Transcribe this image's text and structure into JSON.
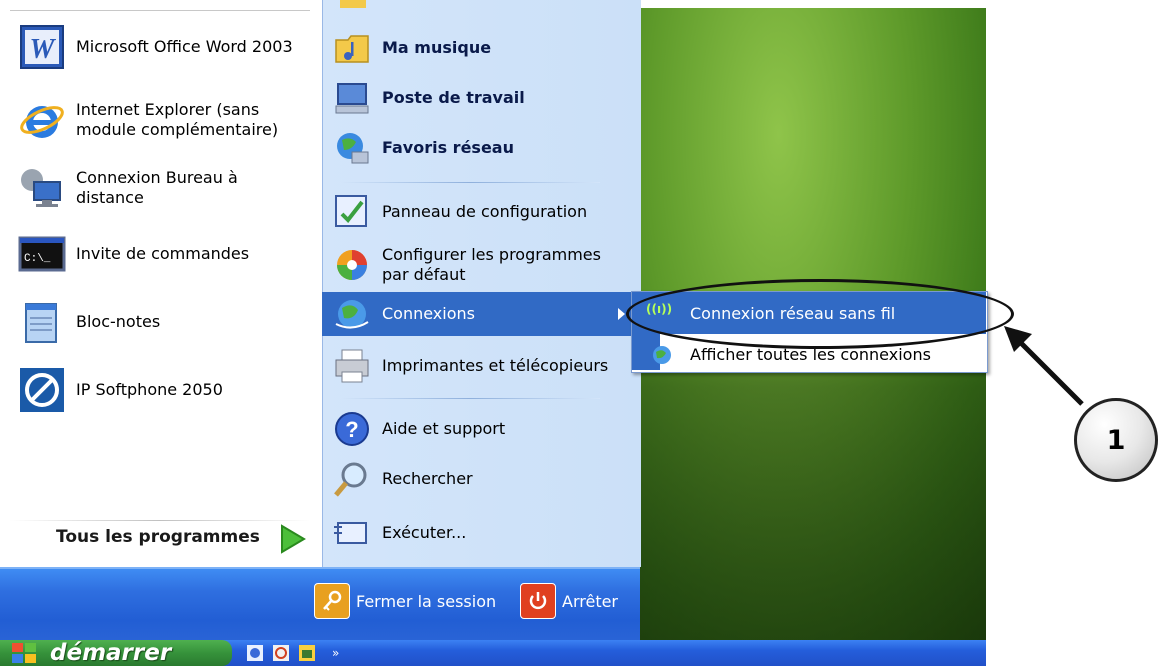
{
  "left_programs": [
    {
      "label": "Microsoft Office Word 2003",
      "icon": "word-icon"
    },
    {
      "label": "Internet Explorer (sans module complémentaire)",
      "icon": "internet-explorer-icon"
    },
    {
      "label": "Connexion Bureau à distance",
      "icon": "remote-desktop-icon"
    },
    {
      "label": "Invite de commandes",
      "icon": "command-prompt-icon"
    },
    {
      "label": "Bloc-notes",
      "icon": "notepad-icon"
    },
    {
      "label": "IP Softphone 2050",
      "icon": "softphone-icon"
    }
  ],
  "all_programs_label": "Tous les programmes",
  "right_items": {
    "music": "Ma musique",
    "computer": "Poste de travail",
    "network": "Favoris réseau",
    "control_panel": "Panneau de configuration",
    "default_programs": "Configurer les programmes par défaut",
    "connections": "Connexions",
    "printers": "Imprimantes et télécopieurs",
    "help": "Aide et support",
    "search": "Rechercher",
    "run": "Exécuter..."
  },
  "bottom": {
    "logoff": "Fermer la session",
    "shutdown": "Arrêter"
  },
  "taskbar": {
    "start": "démarrer",
    "more": "»"
  },
  "submenu": {
    "wifi_glyph": "((ı))",
    "wireless": "Connexion réseau sans fil",
    "show_all": "Afficher toutes les connexions"
  },
  "callout": {
    "number": "1"
  },
  "colors": {
    "selection": "#316ac5",
    "panel": "#d3e5fa",
    "start_green": "#36923b"
  }
}
